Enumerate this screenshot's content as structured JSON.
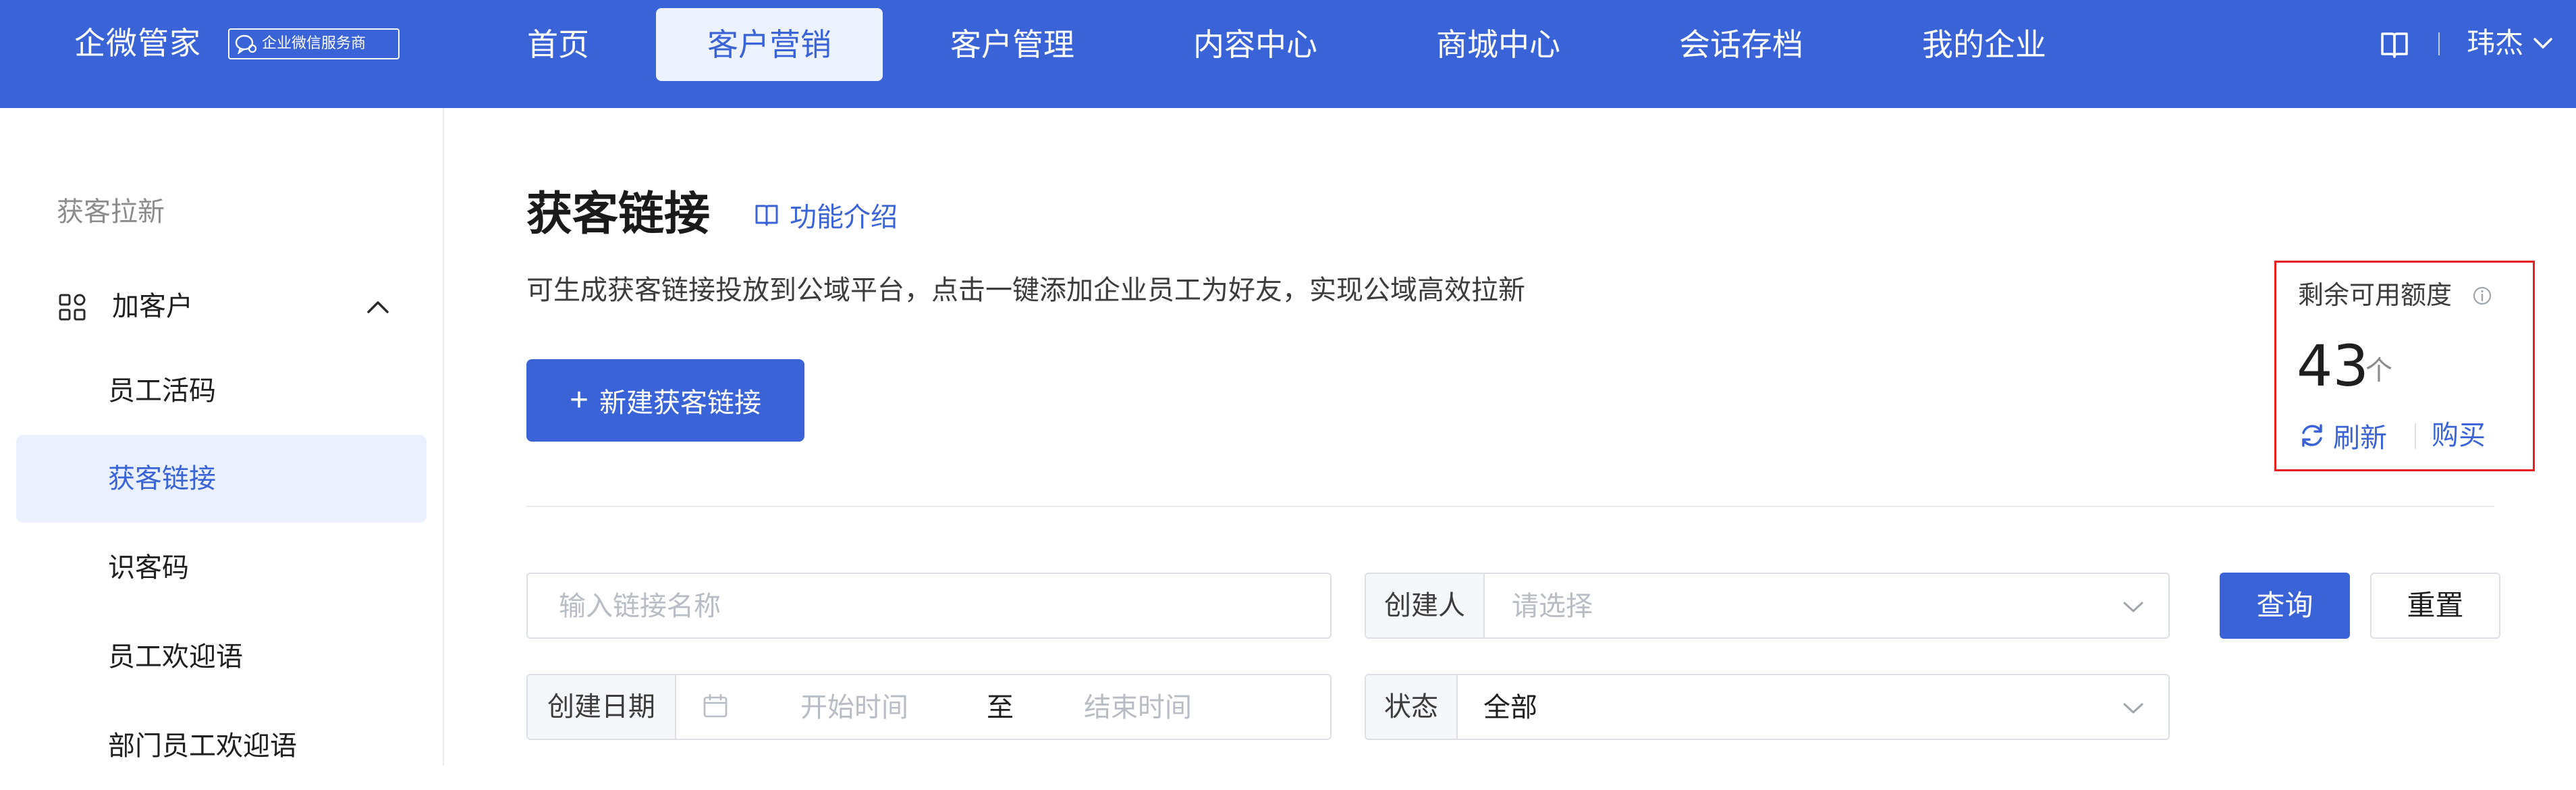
{
  "header": {
    "brand": "企微管家",
    "badge": "企业微信服务商",
    "nav": [
      {
        "label": "首页",
        "active": false
      },
      {
        "label": "客户营销",
        "active": true
      },
      {
        "label": "客户管理",
        "active": false
      },
      {
        "label": "内容中心",
        "active": false
      },
      {
        "label": "商城中心",
        "active": false
      },
      {
        "label": "会话存档",
        "active": false
      },
      {
        "label": "我的企业",
        "active": false
      }
    ],
    "user_name": "玮杰"
  },
  "sidebar": {
    "group_title": "获客拉新",
    "parent": {
      "label": "加客户",
      "expanded": true
    },
    "items": [
      {
        "label": "员工活码",
        "active": false
      },
      {
        "label": "获客链接",
        "active": true
      },
      {
        "label": "识客码",
        "active": false
      },
      {
        "label": "员工欢迎语",
        "active": false
      },
      {
        "label": "部门员工欢迎语",
        "active": false
      }
    ]
  },
  "main": {
    "title": "获客链接",
    "intro_link": "功能介绍",
    "description": "可生成获客链接投放到公域平台，点击一键添加企业员工为好友，实现公域高效拉新",
    "new_button": "新建获客链接",
    "quota": {
      "label": "剩余可用额度",
      "value": "43",
      "unit": "个",
      "refresh": "刷新",
      "buy": "购买"
    },
    "filters": {
      "name_placeholder": "输入链接名称",
      "creator_label": "创建人",
      "creator_placeholder": "请选择",
      "query": "查询",
      "reset": "重置",
      "date_label": "创建日期",
      "start_placeholder": "开始时间",
      "range_sep": "至",
      "end_placeholder": "结束时间",
      "status_label": "状态",
      "status_value": "全部"
    }
  },
  "colors": {
    "primary": "#3a63d8",
    "highlight_border": "#e62020",
    "sidebar_active_bg": "#eaf0fd"
  }
}
